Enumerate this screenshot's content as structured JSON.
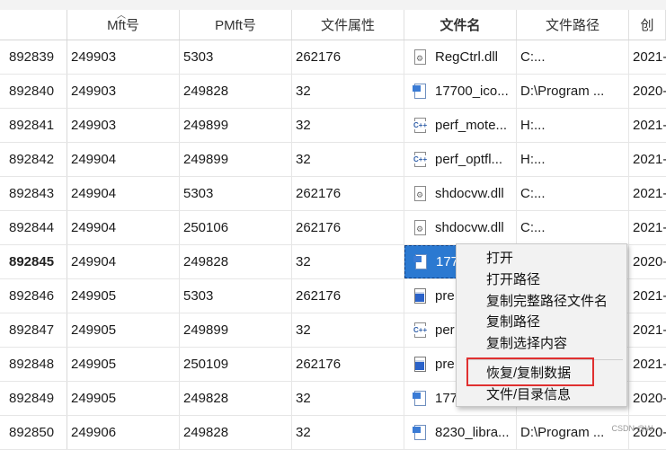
{
  "columns": [
    "",
    "Mft号",
    "PMft号",
    "文件属性",
    "文件名",
    "文件路径",
    "创"
  ],
  "rows": [
    {
      "id": "892839",
      "mft": "249903",
      "pmft": "5303",
      "attr": "262176",
      "icon": "dll",
      "name": "RegCtrl.dll",
      "path": "C:...",
      "date": "2021-"
    },
    {
      "id": "892840",
      "mft": "249903",
      "pmft": "249828",
      "attr": "32",
      "icon": "img",
      "name": "17700_ico...",
      "path": "D:\\Program ...",
      "date": "2020-"
    },
    {
      "id": "892841",
      "mft": "249903",
      "pmft": "249899",
      "attr": "32",
      "icon": "cpp",
      "name": "perf_mote...",
      "path": "H:...",
      "date": "2021-"
    },
    {
      "id": "892842",
      "mft": "249904",
      "pmft": "249899",
      "attr": "32",
      "icon": "cpp",
      "name": "perf_optfl...",
      "path": "H:...",
      "date": "2021-"
    },
    {
      "id": "892843",
      "mft": "249904",
      "pmft": "5303",
      "attr": "262176",
      "icon": "dll",
      "name": "shdocvw.dll",
      "path": "C:...",
      "date": "2021-"
    },
    {
      "id": "892844",
      "mft": "249904",
      "pmft": "250106",
      "attr": "262176",
      "icon": "dll",
      "name": "shdocvw.dll",
      "path": "C:...",
      "date": "2021-"
    },
    {
      "id": "892845",
      "mft": "249904",
      "pmft": "249828",
      "attr": "32",
      "icon": "img",
      "name": "177",
      "path": "",
      "date": "2020-"
    },
    {
      "id": "892846",
      "mft": "249905",
      "pmft": "5303",
      "attr": "262176",
      "icon": "exe",
      "name": "pre",
      "path": "",
      "date": "2021-"
    },
    {
      "id": "892847",
      "mft": "249905",
      "pmft": "249899",
      "attr": "32",
      "icon": "cpp",
      "name": "per",
      "path": "",
      "date": "2021-"
    },
    {
      "id": "892848",
      "mft": "249905",
      "pmft": "250109",
      "attr": "262176",
      "icon": "exe",
      "name": "pre",
      "path": "",
      "date": "2021-"
    },
    {
      "id": "892849",
      "mft": "249905",
      "pmft": "249828",
      "attr": "32",
      "icon": "img",
      "name": "177",
      "path": "",
      "date": "2020-"
    },
    {
      "id": "892850",
      "mft": "249906",
      "pmft": "249828",
      "attr": "32",
      "icon": "img",
      "name": "8230_libra...",
      "path": "D:\\Program ...",
      "date": "2020-"
    }
  ],
  "selected_row_index": 6,
  "context_menu": {
    "items": [
      "打开",
      "打开路径",
      "复制完整路径文件名",
      "复制路径",
      "复制选择内容"
    ],
    "items_after_separator": [
      "恢复/复制数据",
      "文件/目录信息"
    ],
    "highlighted_item": "恢复/复制数据"
  },
  "watermark": "CSDN @W-",
  "colors": {
    "selection": "#2b79d1",
    "highlight_box": "#e03030"
  }
}
